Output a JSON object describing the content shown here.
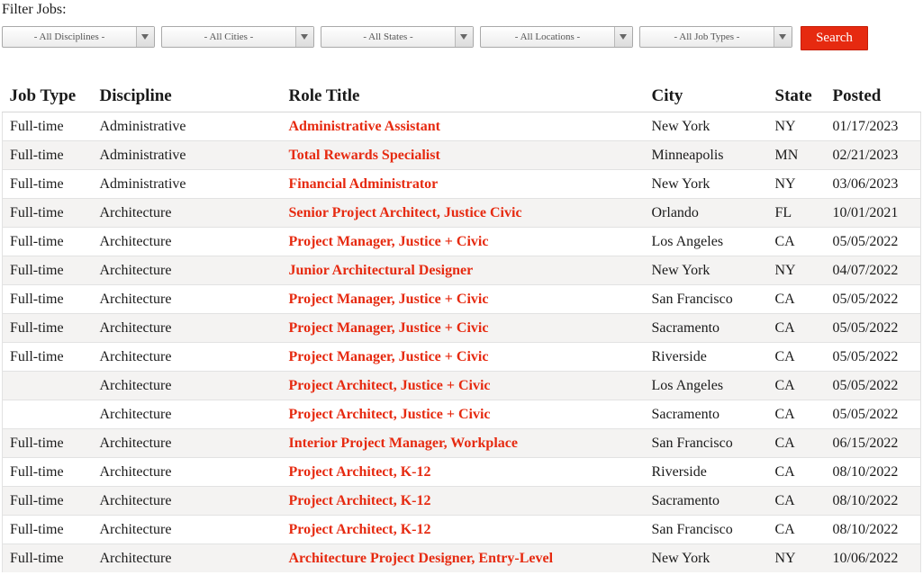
{
  "filters": {
    "label": "Filter Jobs:",
    "disciplines": "- All Disciplines -",
    "cities": "- All Cities -",
    "states": "- All States -",
    "locations": "- All Locations -",
    "job_types": "- All Job Types -",
    "search_label": "Search",
    "arrow_icon": "chevron-down-icon"
  },
  "table": {
    "headers": [
      "Job Type",
      "Discipline",
      "Role Title",
      "City",
      "State",
      "Posted"
    ],
    "rows": [
      [
        "Full-time",
        "Administrative",
        "Administrative Assistant",
        "New York",
        "NY",
        "01/17/2023"
      ],
      [
        "Full-time",
        "Administrative",
        "Total Rewards Specialist",
        "Minneapolis",
        "MN",
        "02/21/2023"
      ],
      [
        "Full-time",
        "Administrative",
        "Financial Administrator",
        "New York",
        "NY",
        "03/06/2023"
      ],
      [
        "Full-time",
        "Architecture",
        "Senior Project Architect, Justice Civic",
        "Orlando",
        "FL",
        "10/01/2021"
      ],
      [
        "Full-time",
        "Architecture",
        "Project Manager, Justice + Civic",
        "Los Angeles",
        "CA",
        "05/05/2022"
      ],
      [
        "Full-time",
        "Architecture",
        "Junior Architectural Designer",
        "New York",
        "NY",
        "04/07/2022"
      ],
      [
        "Full-time",
        "Architecture",
        "Project Manager, Justice + Civic",
        "San Francisco",
        "CA",
        "05/05/2022"
      ],
      [
        "Full-time",
        "Architecture",
        "Project Manager, Justice + Civic",
        "Sacramento",
        "CA",
        "05/05/2022"
      ],
      [
        "Full-time",
        "Architecture",
        "Project Manager, Justice + Civic",
        "Riverside",
        "CA",
        "05/05/2022"
      ],
      [
        "",
        "Architecture",
        "Project Architect, Justice + Civic",
        "Los Angeles",
        "CA",
        "05/05/2022"
      ],
      [
        "",
        "Architecture",
        "Project Architect, Justice + Civic",
        "Sacramento",
        "CA",
        "05/05/2022"
      ],
      [
        "Full-time",
        "Architecture",
        "Interior Project Manager, Workplace",
        "San Francisco",
        "CA",
        "06/15/2022"
      ],
      [
        "Full-time",
        "Architecture",
        "Project Architect, K-12",
        "Riverside",
        "CA",
        "08/10/2022"
      ],
      [
        "Full-time",
        "Architecture",
        "Project Architect, K-12",
        "Sacramento",
        "CA",
        "08/10/2022"
      ],
      [
        "Full-time",
        "Architecture",
        "Project Architect, K-12",
        "San Francisco",
        "CA",
        "08/10/2022"
      ],
      [
        "Full-time",
        "Architecture",
        "Architecture Project Designer, Entry-Level",
        "New York",
        "NY",
        "10/06/2022"
      ]
    ]
  },
  "colors": {
    "accent": "#e62a10",
    "stripe": "#f4f3f2"
  }
}
